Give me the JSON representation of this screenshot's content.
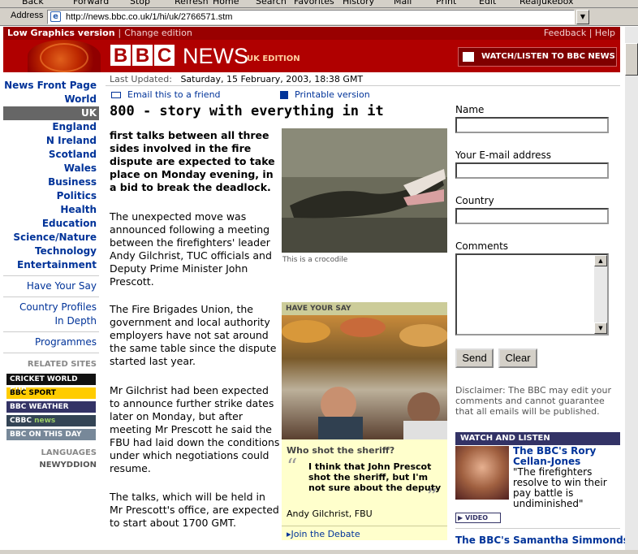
{
  "browser": {
    "menu_labels": [
      "Back",
      "Forward",
      "Stop",
      "Refresh",
      "Home",
      "Search",
      "Favorites",
      "History",
      "Mail",
      "Print",
      "Edit",
      "RealJukebox"
    ],
    "address_label": "Address",
    "url": "http://news.bbc.co.uk/1/hi/uk/2766571.stm"
  },
  "topbar": {
    "low_graphics": "Low Graphics version",
    "separator": "|",
    "change_edition": "Change edition",
    "feedback": "Feedback",
    "help": "Help",
    "feedback_sep": "|"
  },
  "banner": {
    "bbc_letters": [
      "B",
      "B",
      "C"
    ],
    "news_word": "NEWS",
    "edition": "UK EDITION",
    "watch_listen": "WATCH/LISTEN TO BBC NEWS"
  },
  "nav": {
    "items": [
      {
        "label": "News Front Page"
      },
      {
        "label": "World"
      },
      {
        "label": "UK"
      },
      {
        "label": "England"
      },
      {
        "label": "N Ireland"
      },
      {
        "label": "Scotland"
      },
      {
        "label": "Wales"
      },
      {
        "label": "Business"
      },
      {
        "label": "Politics"
      },
      {
        "label": "Health"
      },
      {
        "label": "Education"
      },
      {
        "label": "Science/Nature"
      },
      {
        "label": "Technology"
      },
      {
        "label": "Entertainment"
      }
    ],
    "have_your_say": "Have Your Say",
    "country_profiles": "Country Profiles",
    "in_depth": "In Depth",
    "programmes": "Programmes",
    "related_label": "RELATED SITES",
    "related": [
      "CRICKET WORLD CUP",
      "SPORT",
      "WEATHER",
      "news",
      "ON THIS DAY"
    ],
    "languages_label": "LANGUAGES",
    "language": "NEWYDDION"
  },
  "article": {
    "last_updated_label": "Last Updated:",
    "last_updated": "Saturday, 15 February, 2003, 18:38 GMT",
    "email_link": "Email this to a friend",
    "print_link": "Printable version",
    "headline": "800 - story with everything in it",
    "lead": "first talks between all three sides involved in the fire dispute are expected to take place on Monday evening, in a bid to break the deadlock.",
    "paragraphs": [
      "The unexpected move was announced following a meeting between the firefighters' leader Andy Gilchrist, TUC officials and Deputy Prime Minister John Prescott.",
      "The Fire Brigades Union, the government and local authority employers have not sat around the same table since the dispute started last year.",
      "Mr Gilchrist had been expected to announce further strike dates later on Monday, but after meeting Mr Prescott he said the FBU had laid down the conditions under which negotiations could resume.",
      "The talks, which will be held in Mr Prescott's office, are expected to start about 1700 GMT."
    ],
    "image_caption": "This is a crocodile"
  },
  "hys": {
    "heading": "HAVE YOUR SAY",
    "question": "Who shot the sheriff?",
    "open_quote": "“",
    "quote": "I think that John Prescot shot the sheriff, but I'm not sure about the deputy",
    "close_quote": "”",
    "author": "Andy Gilchrist, FBU",
    "join": "Join the Debate"
  },
  "form": {
    "name_label": "Name",
    "email_label": "Your E-mail address",
    "country_label": "Country",
    "comments_label": "Comments",
    "send": "Send",
    "clear": "Clear",
    "disclaimer": "Disclaimer: The BBC may edit your comments and cannot guarantee that all emails will be published."
  },
  "watch": {
    "heading": "WATCH AND LISTEN",
    "title": "The BBC's Rory Cellan-Jones",
    "quote": "\"The firefighters resolve to win their pay battle is undiminished\"",
    "video": "VIDEO",
    "title2": "The BBC's Samantha Simmonds"
  }
}
